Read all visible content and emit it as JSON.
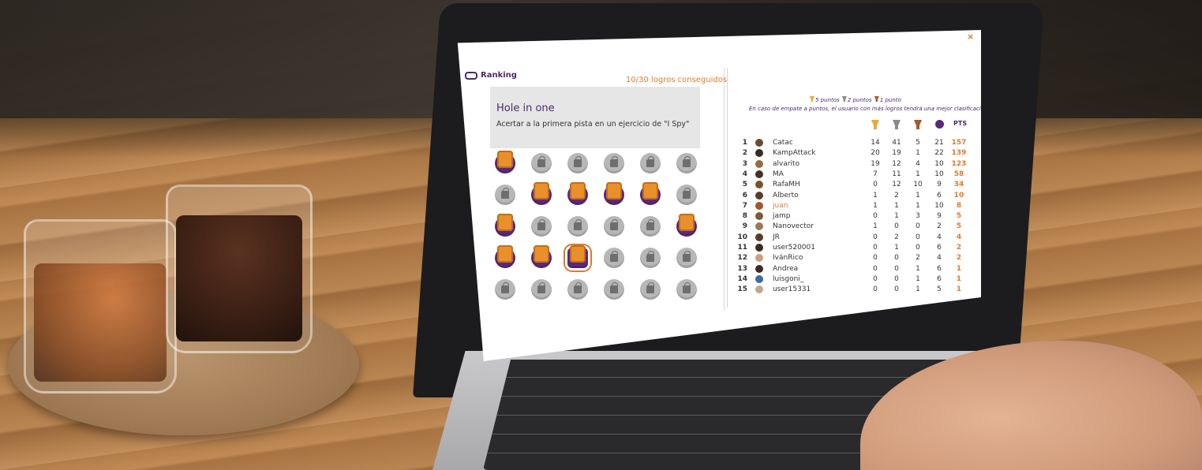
{
  "modal": {
    "close_label": "×",
    "header": "Ranking",
    "achievements_count": "10/30 logros conseguidos"
  },
  "achievement": {
    "title": "Hole in one",
    "description": "Acertar a la primera pista en un ejercicio de \"I Spy\""
  },
  "badges": {
    "rows": [
      [
        "on",
        "locked",
        "locked",
        "locked",
        "locked",
        "locked"
      ],
      [
        "locked",
        "on",
        "on",
        "on",
        "on",
        "locked"
      ],
      [
        "on",
        "locked",
        "locked",
        "locked",
        "locked",
        "on"
      ],
      [
        "on",
        "on",
        "selected",
        "locked",
        "locked",
        "locked"
      ],
      [
        "locked",
        "locked",
        "locked",
        "locked",
        "locked",
        "locked"
      ]
    ]
  },
  "ranking": {
    "legend": {
      "gold": "5 puntos",
      "silver": "2 puntos",
      "bronze": "1 punto",
      "tie_note": "En caso de empate a puntos, el usuario con más logros tendrá una mejor clasificación."
    },
    "pts_header": "PTS",
    "colors": {
      "gold": "#e8a93a",
      "silver": "#8a8a8a",
      "bronze": "#a65a2a",
      "accent": "#e07a2c",
      "purple": "#5a2a7a"
    },
    "rows": [
      {
        "pos": "1",
        "name": "Catac",
        "gold": "14",
        "silver": "41",
        "bronze": "5",
        "check": "21",
        "pts": "157"
      },
      {
        "pos": "2",
        "name": "KampAttack",
        "gold": "20",
        "silver": "19",
        "bronze": "1",
        "check": "22",
        "pts": "139"
      },
      {
        "pos": "3",
        "name": "alvarito",
        "gold": "19",
        "silver": "12",
        "bronze": "4",
        "check": "10",
        "pts": "123"
      },
      {
        "pos": "4",
        "name": "MA",
        "gold": "7",
        "silver": "11",
        "bronze": "1",
        "check": "10",
        "pts": "58"
      },
      {
        "pos": "5",
        "name": "RafaMH",
        "gold": "0",
        "silver": "12",
        "bronze": "10",
        "check": "9",
        "pts": "34"
      },
      {
        "pos": "6",
        "name": "Alberto",
        "gold": "1",
        "silver": "2",
        "bronze": "1",
        "check": "6",
        "pts": "10"
      },
      {
        "pos": "7",
        "name": "juan",
        "gold": "1",
        "silver": "1",
        "bronze": "1",
        "check": "10",
        "pts": "8"
      },
      {
        "pos": "8",
        "name": "jamp",
        "gold": "0",
        "silver": "1",
        "bronze": "3",
        "check": "9",
        "pts": "5"
      },
      {
        "pos": "9",
        "name": "Nanovector",
        "gold": "1",
        "silver": "0",
        "bronze": "0",
        "check": "2",
        "pts": "5"
      },
      {
        "pos": "10",
        "name": "JR",
        "gold": "0",
        "silver": "2",
        "bronze": "0",
        "check": "4",
        "pts": "4"
      },
      {
        "pos": "11",
        "name": "user520001",
        "gold": "0",
        "silver": "1",
        "bronze": "0",
        "check": "6",
        "pts": "2"
      },
      {
        "pos": "12",
        "name": "IvánRico",
        "gold": "0",
        "silver": "0",
        "bronze": "2",
        "check": "4",
        "pts": "2"
      },
      {
        "pos": "13",
        "name": "Andrea",
        "gold": "0",
        "silver": "0",
        "bronze": "1",
        "check": "6",
        "pts": "1"
      },
      {
        "pos": "14",
        "name": "luisgoni_",
        "gold": "0",
        "silver": "0",
        "bronze": "1",
        "check": "6",
        "pts": "1"
      },
      {
        "pos": "15",
        "name": "user15331",
        "gold": "0",
        "silver": "0",
        "bronze": "1",
        "check": "5",
        "pts": "1"
      }
    ]
  }
}
